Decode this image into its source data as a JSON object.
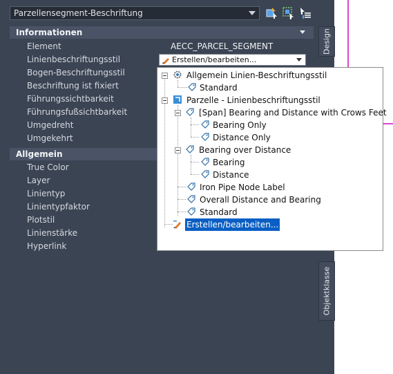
{
  "selector": {
    "value": "Parzellensegment-Beschriftung"
  },
  "toolbar_icons": [
    "quick-select-icon",
    "select-objects-icon",
    "toggle-pickadd-icon"
  ],
  "categories": {
    "info": "Informationen",
    "general": "Allgemein"
  },
  "info_props": [
    {
      "label": "Element",
      "value": "AECC_PARCEL_SEGMENT"
    },
    {
      "label": "Linienbeschriftungsstil",
      "value": "Erstellen/bearbeiten..."
    },
    {
      "label": "Bogen-Beschriftungsstil"
    },
    {
      "label": "Beschriftung ist fixiert"
    },
    {
      "label": "Führungssichtbarkeit"
    },
    {
      "label": "Führungsfußsichtbarkeit"
    },
    {
      "label": "Umgedreht"
    },
    {
      "label": "Umgekehrt"
    }
  ],
  "general_props": [
    {
      "label": "True Color"
    },
    {
      "label": "Layer"
    },
    {
      "label": "Linientyp"
    },
    {
      "label": "Linientypfaktor"
    },
    {
      "label": "Plotstil"
    },
    {
      "label": "Linienstärke"
    },
    {
      "label": "Hyperlink"
    }
  ],
  "side_tabs": {
    "design": "Design",
    "object_class": "Objektklasse"
  },
  "tree": {
    "root1": "Allgemein Linien-Beschriftungsstil",
    "root1_child": "Standard",
    "root2": "Parzelle - Linienbeschriftungsstil",
    "span_group": "[Span] Bearing and Distance with Crows Feet",
    "span_children": [
      "Bearing Only",
      "Distance Only"
    ],
    "bod_group": "Bearing over Distance",
    "bod_children": [
      "Bearing",
      "Distance"
    ],
    "others": [
      "Iron Pipe Node Label",
      "Overall Distance and Bearing",
      "Standard"
    ],
    "create_edit": "Erstellen/bearbeiten..."
  },
  "colors": {
    "panel": "#3b4453",
    "header": "#4a5365",
    "selection": "#0a5fc4",
    "accent_magenta": "#d946d0"
  }
}
